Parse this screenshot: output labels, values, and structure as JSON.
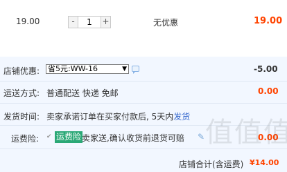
{
  "item": {
    "unit_price": "19.00",
    "quantity": "1",
    "minus_label": "-",
    "plus_label": "+",
    "discount": "无优惠",
    "subtotal": "19.00"
  },
  "shop_discount": {
    "label": "店铺优惠:",
    "selected": "省5元:WW-16",
    "amount": "-5.00"
  },
  "shipping_method": {
    "label": "运送方式:",
    "value": "普通配送 快递 免邮",
    "amount": "0.00"
  },
  "ship_time": {
    "label": "发货时间:",
    "value": "卖家承诺订单在买家付款后, 5天内",
    "link": "发货"
  },
  "shipping_insurance": {
    "label": "运费险:",
    "tag": "运费险",
    "value": "卖家送,确认收货前退货可赔",
    "amount": "0.00"
  },
  "total": {
    "label": "店铺合计(含运费)",
    "amount": "¥14.00"
  },
  "watermark": "值值值",
  "colors": {
    "price_red": "#ff4400",
    "panel_bg": "#f2f7ff",
    "insurance_green": "#2aa876",
    "link_blue": "#3366cc"
  },
  "icons": [
    "chat-icon",
    "checkbox-icon",
    "edit-icon"
  ]
}
